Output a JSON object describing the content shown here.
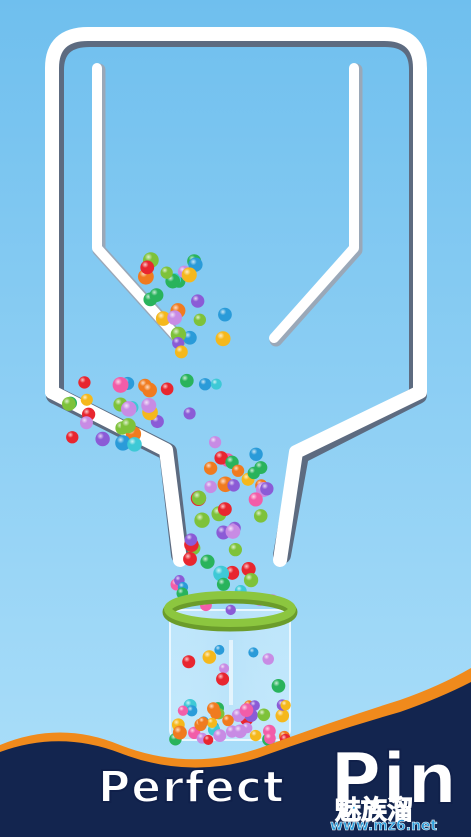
{
  "game": {
    "title_word_1": "Perfect",
    "title_word_2": "Pin",
    "watermark_text": "魅族溜",
    "watermark_url": "www.mz6.net"
  },
  "colors": {
    "background_top": "#79c3f0",
    "background_bottom": "#a8dcf8",
    "wall": "#ffffff",
    "wall_shadow": "#5d6b80",
    "wave_navy": "#13254f",
    "wave_orange": "#f08a1c",
    "cup_rim": "#8cc63f",
    "ball_colors": [
      "#e8262f",
      "#f07b1f",
      "#29b35c",
      "#8b5bd6",
      "#2a9bd9",
      "#f25da8",
      "#f5b81c",
      "#c88be4",
      "#3ec9d6",
      "#7ec23a"
    ]
  },
  "icons": [
    "pin-left-icon",
    "pin-right-icon"
  ]
}
